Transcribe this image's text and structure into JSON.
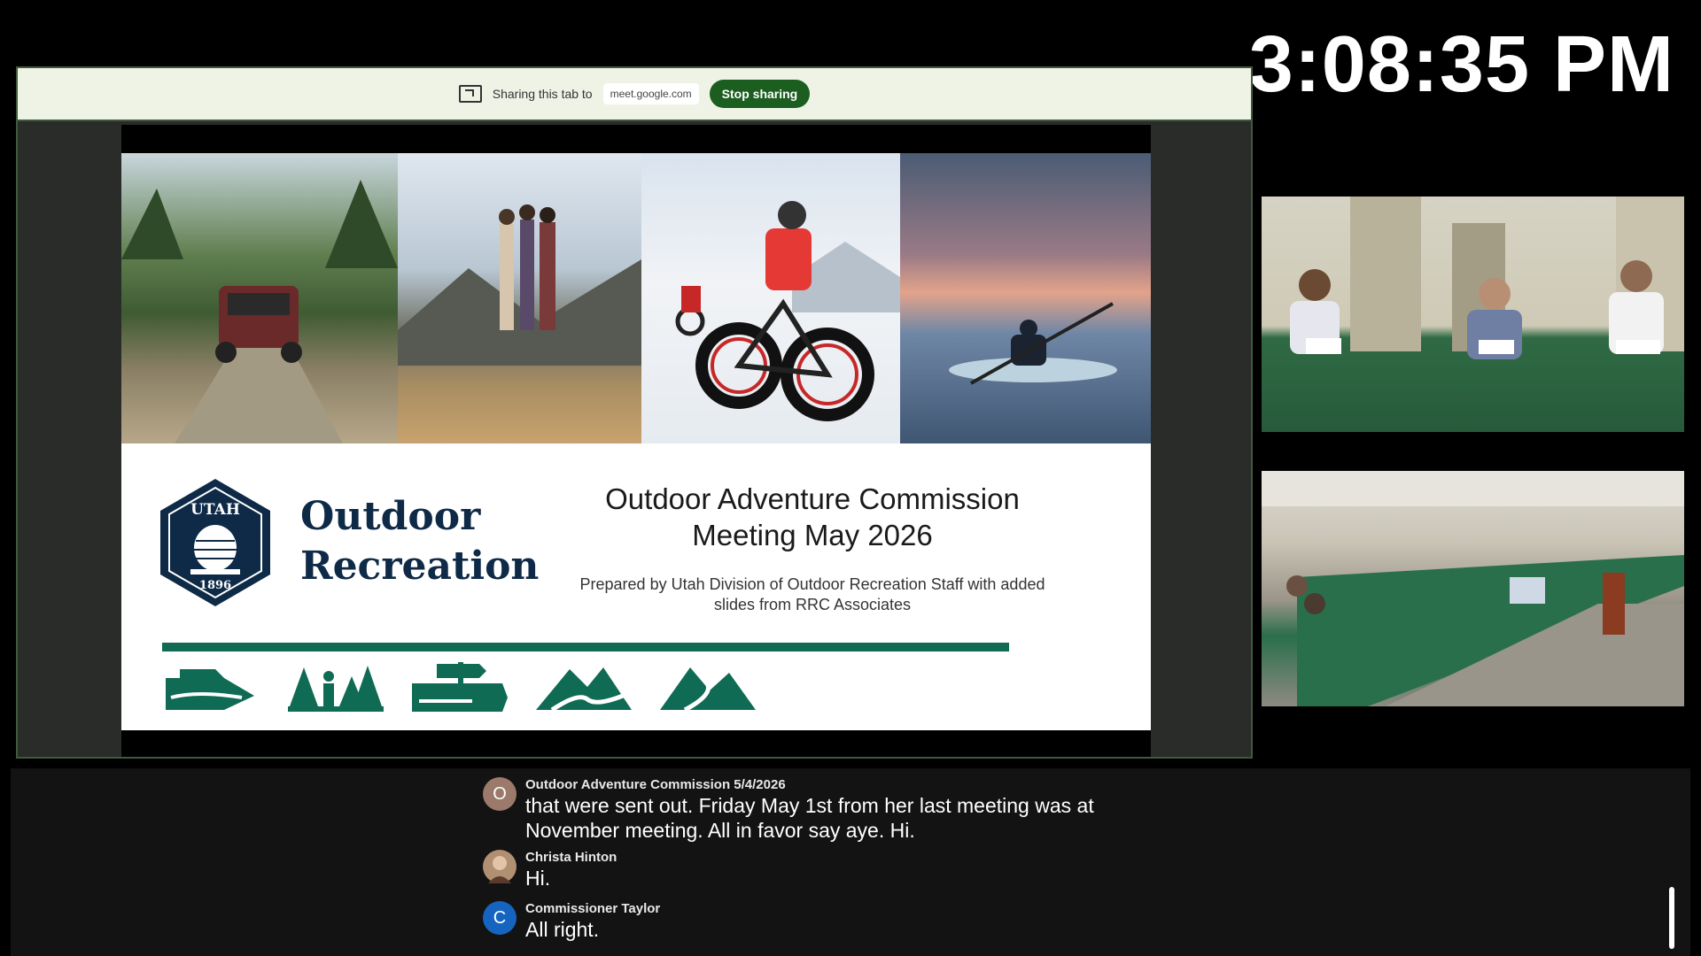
{
  "clock": {
    "time": "3:08:35 PM"
  },
  "share_bar": {
    "label": "Sharing this tab to",
    "url": "meet.google.com",
    "stop_label": "Stop sharing"
  },
  "slide": {
    "logo": {
      "seal_text_top": "UTAH",
      "seal_text_bottom": "1896",
      "title_line1": "Outdoor",
      "title_line2": "Recreation"
    },
    "title_line1": "Outdoor Adventure Commission",
    "title_line2": "Meeting May 2026",
    "subtitle_line1": "Prepared by Utah Division of Outdoor Recreation Staff with added",
    "subtitle_line2": "slides from RRC Associates",
    "icons": [
      "boat-icon",
      "trees-person-icon",
      "trail-sign-icon",
      "mountain-river-icon",
      "mountain-road-icon"
    ]
  },
  "captions": [
    {
      "avatar": "O",
      "avatar_color": "#9c7a6b",
      "name": "Outdoor Adventure Commission 5/4/2026",
      "line1": "that were sent out. Friday May 1st from her last meeting was at",
      "line2": "November meeting. All in favor say aye. Hi."
    },
    {
      "avatar": "",
      "avatar_color": "#b08f72",
      "name": "Christa Hinton",
      "line1": "Hi."
    },
    {
      "avatar": "C",
      "avatar_color": "#1565c0",
      "name": "Commissioner Taylor",
      "line1": "All right."
    }
  ],
  "colors": {
    "share_bar_bg": "#eef3e6",
    "stop_button": "#1b5e20",
    "slide_accent": "#0f6b54",
    "logo_navy": "#0e2a47"
  }
}
